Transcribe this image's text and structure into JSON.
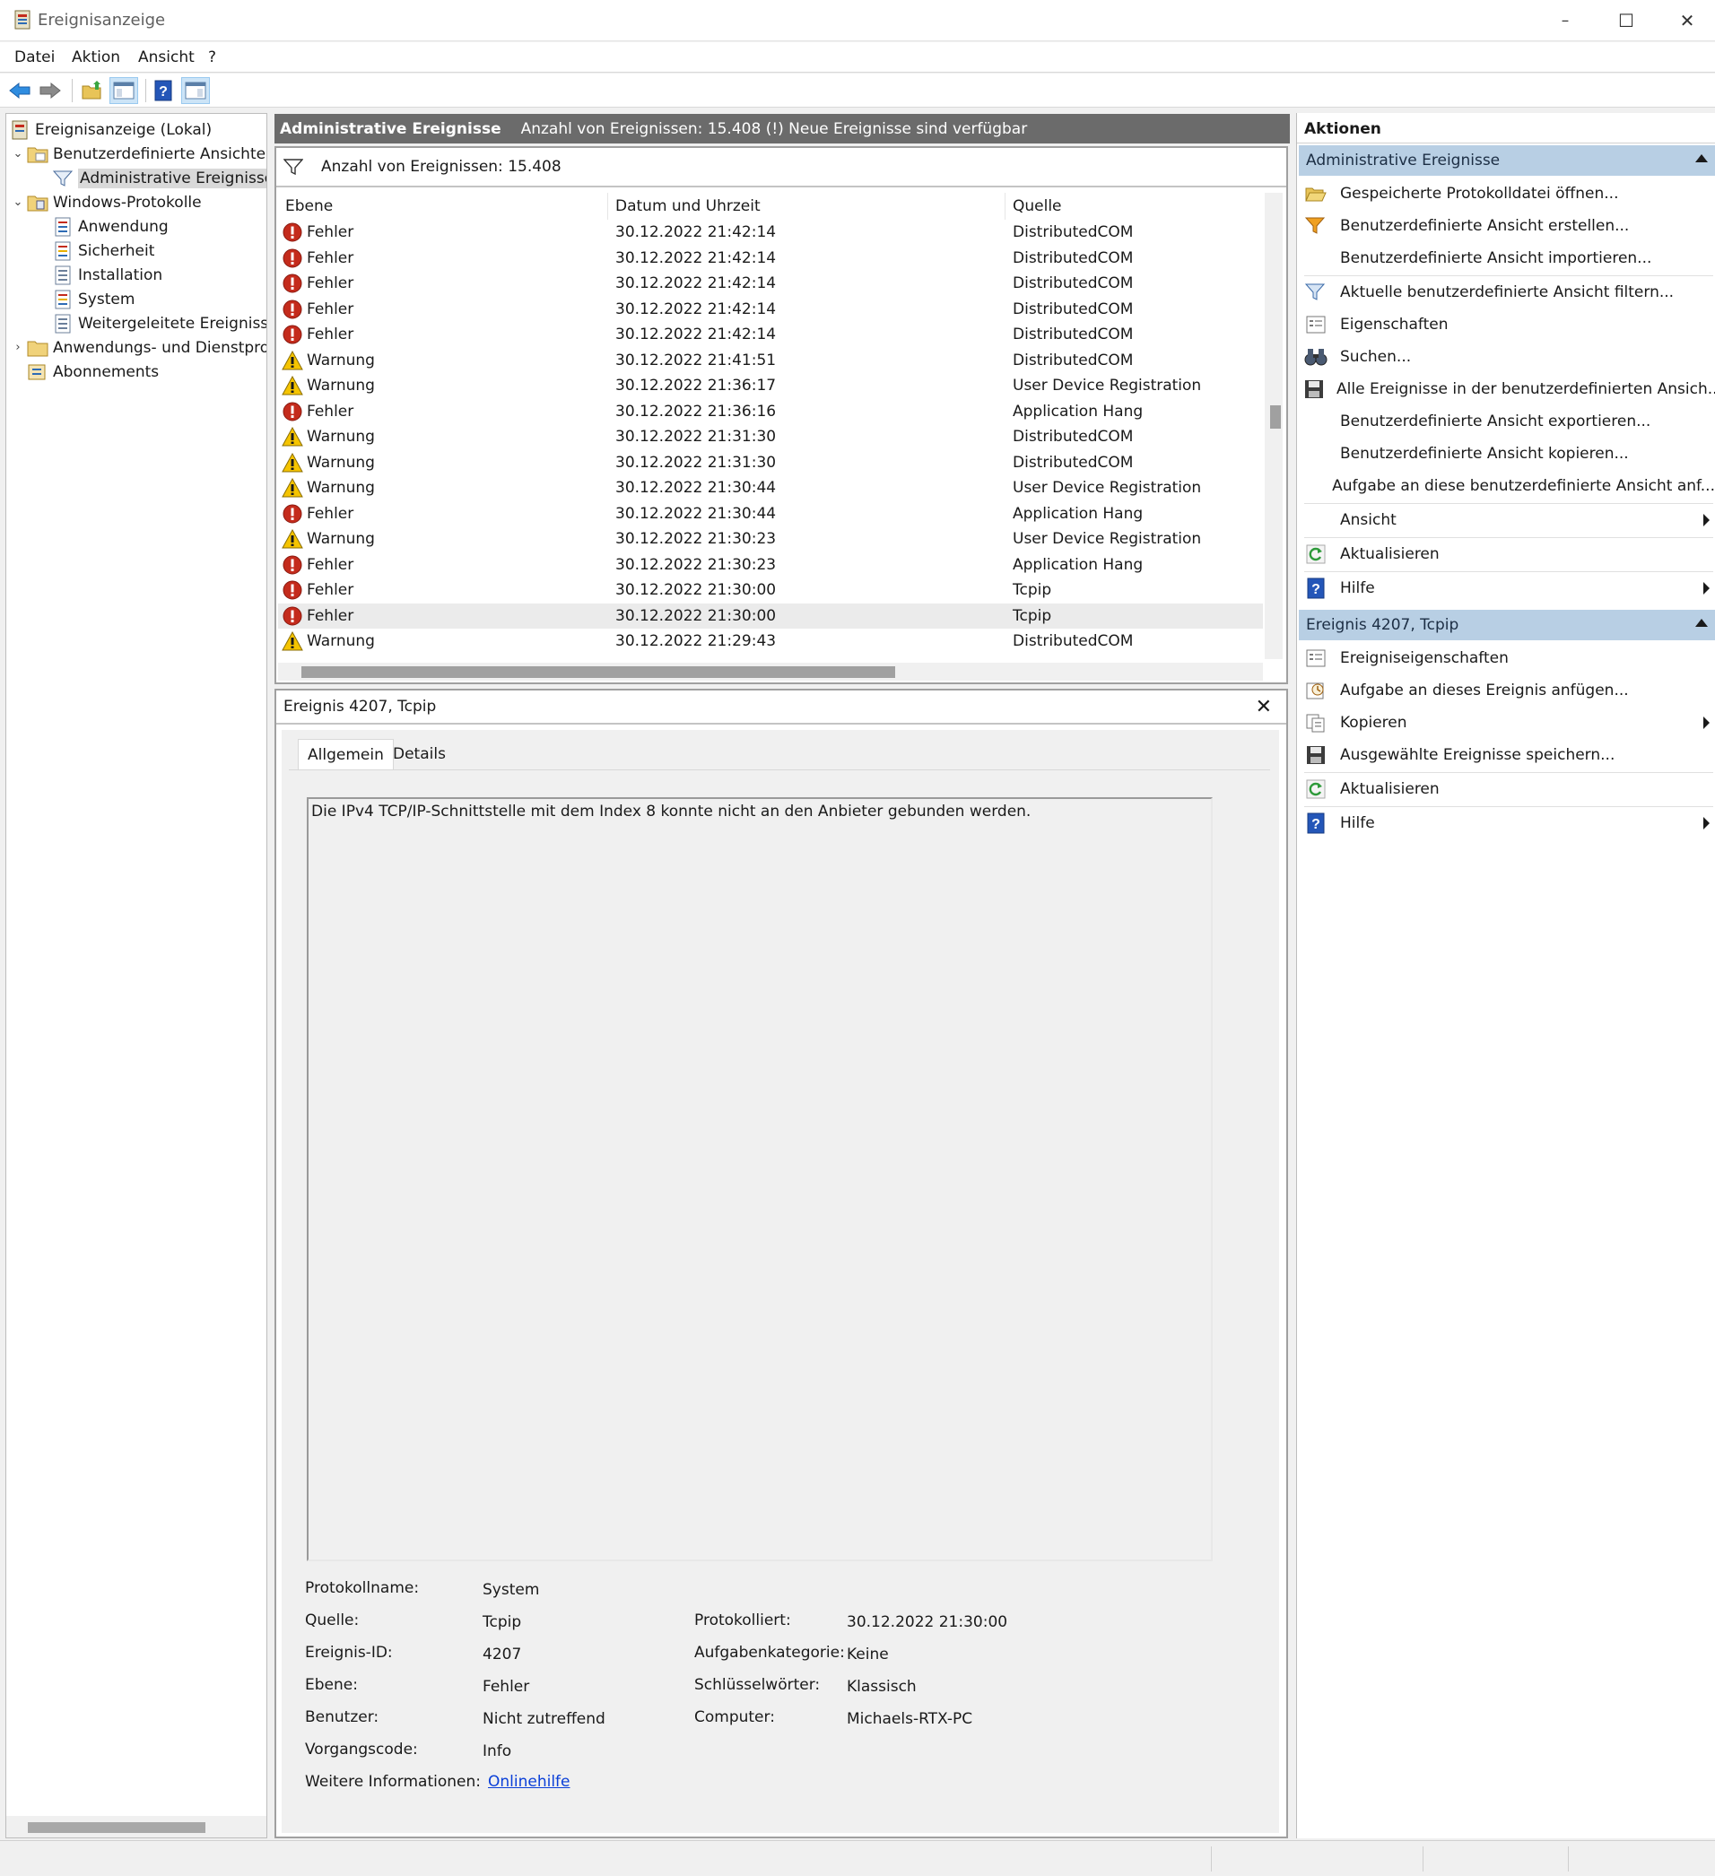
{
  "window": {
    "title": "Ereignisanzeige",
    "controls": {
      "minimize": "–",
      "maximize": "☐",
      "close": "✕"
    }
  },
  "menu": [
    "Datei",
    "Aktion",
    "Ansicht",
    "?"
  ],
  "tree": {
    "root": "Ereignisanzeige (Lokal)",
    "custom_views": "Benutzerdefinierte Ansichten",
    "admin_events": "Administrative Ereignisse",
    "windows_logs": "Windows-Protokolle",
    "logs": [
      "Anwendung",
      "Sicherheit",
      "Installation",
      "System",
      "Weitergeleitete Ereignisse"
    ],
    "app_services": "Anwendungs- und Dienstprotokolle",
    "subscriptions": "Abonnements"
  },
  "middle": {
    "header_title": "Administrative Ereignisse",
    "header_info": "Anzahl von Ereignissen: 15.408 (!) Neue Ereignisse sind verfügbar",
    "filter_text": "Anzahl von Ereignissen: 15.408",
    "columns": [
      "Ebene",
      "Datum und Uhrzeit",
      "Quelle"
    ],
    "rows": [
      {
        "level": "Fehler",
        "type": "error",
        "date": "30.12.2022 21:42:14",
        "source": "DistributedCOM"
      },
      {
        "level": "Fehler",
        "type": "error",
        "date": "30.12.2022 21:42:14",
        "source": "DistributedCOM"
      },
      {
        "level": "Fehler",
        "type": "error",
        "date": "30.12.2022 21:42:14",
        "source": "DistributedCOM"
      },
      {
        "level": "Fehler",
        "type": "error",
        "date": "30.12.2022 21:42:14",
        "source": "DistributedCOM"
      },
      {
        "level": "Fehler",
        "type": "error",
        "date": "30.12.2022 21:42:14",
        "source": "DistributedCOM"
      },
      {
        "level": "Warnung",
        "type": "warning",
        "date": "30.12.2022 21:41:51",
        "source": "DistributedCOM"
      },
      {
        "level": "Warnung",
        "type": "warning",
        "date": "30.12.2022 21:36:17",
        "source": "User Device Registration"
      },
      {
        "level": "Fehler",
        "type": "error",
        "date": "30.12.2022 21:36:16",
        "source": "Application Hang"
      },
      {
        "level": "Warnung",
        "type": "warning",
        "date": "30.12.2022 21:31:30",
        "source": "DistributedCOM"
      },
      {
        "level": "Warnung",
        "type": "warning",
        "date": "30.12.2022 21:31:30",
        "source": "DistributedCOM"
      },
      {
        "level": "Warnung",
        "type": "warning",
        "date": "30.12.2022 21:30:44",
        "source": "User Device Registration"
      },
      {
        "level": "Fehler",
        "type": "error",
        "date": "30.12.2022 21:30:44",
        "source": "Application Hang"
      },
      {
        "level": "Warnung",
        "type": "warning",
        "date": "30.12.2022 21:30:23",
        "source": "User Device Registration"
      },
      {
        "level": "Fehler",
        "type": "error",
        "date": "30.12.2022 21:30:23",
        "source": "Application Hang"
      },
      {
        "level": "Fehler",
        "type": "error",
        "date": "30.12.2022 21:30:00",
        "source": "Tcpip"
      },
      {
        "level": "Fehler",
        "type": "error",
        "date": "30.12.2022 21:30:00",
        "source": "Tcpip",
        "selected": true
      },
      {
        "level": "Warnung",
        "type": "warning",
        "date": "30.12.2022 21:29:43",
        "source": "DistributedCOM"
      }
    ]
  },
  "detail": {
    "title": "Ereignis 4207, Tcpip",
    "tabs": [
      "Allgemein",
      "Details"
    ],
    "description": "Die IPv4 TCP/IP-Schnittstelle mit dem Index 8 konnte nicht an den Anbieter gebunden werden.",
    "labels": {
      "log_name": "Protokollname:",
      "source": "Quelle:",
      "event_id": "Ereignis-ID:",
      "level": "Ebene:",
      "user": "Benutzer:",
      "opcode": "Vorgangscode:",
      "more_info": "Weitere Informationen:",
      "logged": "Protokolliert:",
      "task_category": "Aufgabenkategorie:",
      "keywords": "Schlüsselwörter:",
      "computer": "Computer:"
    },
    "values": {
      "log_name": "System",
      "source": "Tcpip",
      "event_id": "4207",
      "level": "Fehler",
      "user": "Nicht zutreffend",
      "opcode": "Info",
      "more_info": "Onlinehilfe",
      "logged": "30.12.2022 21:30:00",
      "task_category": "Keine",
      "keywords": "Klassisch",
      "computer": "Michaels-RTX-PC"
    }
  },
  "actions": {
    "header": "Aktionen",
    "section1": {
      "title": "Administrative Ereignisse",
      "items": [
        {
          "label": "Gespeicherte Protokolldatei öffnen...",
          "icon": "folder-open-icon"
        },
        {
          "label": "Benutzerdefinierte Ansicht erstellen...",
          "icon": "filter-create-icon"
        },
        {
          "label": "Benutzerdefinierte Ansicht importieren...",
          "icon": ""
        },
        {
          "label": "Aktuelle benutzerdefinierte Ansicht filtern...",
          "icon": "filter-icon"
        },
        {
          "label": "Eigenschaften",
          "icon": "properties-icon"
        },
        {
          "label": "Suchen...",
          "icon": "binoculars-icon"
        },
        {
          "label": "Alle Ereignisse in der benutzerdefinierten Ansich...",
          "icon": "save-icon"
        },
        {
          "label": "Benutzerdefinierte Ansicht exportieren...",
          "icon": ""
        },
        {
          "label": "Benutzerdefinierte Ansicht kopieren...",
          "icon": ""
        },
        {
          "label": "Aufgabe an diese benutzerdefinierte Ansicht anf...",
          "icon": ""
        },
        {
          "label": "Ansicht",
          "icon": "",
          "submenu": true
        },
        {
          "label": "Aktualisieren",
          "icon": "refresh-icon"
        },
        {
          "label": "Hilfe",
          "icon": "help-icon",
          "submenu": true
        }
      ]
    },
    "section2": {
      "title": "Ereignis 4207, Tcpip",
      "items": [
        {
          "label": "Ereigniseigenschaften",
          "icon": "properties-icon"
        },
        {
          "label": "Aufgabe an dieses Ereignis anfügen...",
          "icon": "task-icon"
        },
        {
          "label": "Kopieren",
          "icon": "copy-icon",
          "submenu": true
        },
        {
          "label": "Ausgewählte Ereignisse speichern...",
          "icon": "save-icon"
        },
        {
          "label": "Aktualisieren",
          "icon": "refresh-icon"
        },
        {
          "label": "Hilfe",
          "icon": "help-icon",
          "submenu": true
        }
      ]
    }
  },
  "colors": {
    "error": "#c42b1c",
    "warning": "#f5c400",
    "section": "#b8cfe4",
    "header": "#6b6b6b",
    "link": "#0a3fd8"
  }
}
